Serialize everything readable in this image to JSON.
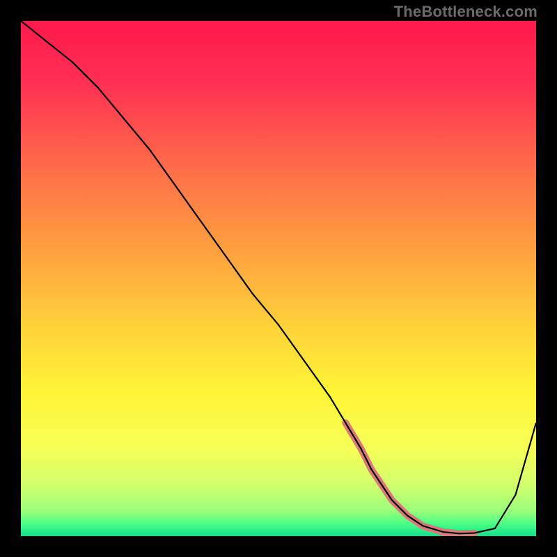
{
  "watermark": "TheBottleneck.com",
  "chart_data": {
    "type": "line",
    "title": "",
    "xlabel": "",
    "ylabel": "",
    "xlim": [
      0,
      100
    ],
    "ylim": [
      0,
      100
    ],
    "grid": false,
    "legend": false,
    "gradient_stops": [
      {
        "pos": 0.0,
        "color": "#ff1a4d"
      },
      {
        "pos": 0.12,
        "color": "#ff3052"
      },
      {
        "pos": 0.28,
        "color": "#ff6b4a"
      },
      {
        "pos": 0.45,
        "color": "#ffa23e"
      },
      {
        "pos": 0.6,
        "color": "#ffd43a"
      },
      {
        "pos": 0.72,
        "color": "#fff536"
      },
      {
        "pos": 0.83,
        "color": "#f6ff57"
      },
      {
        "pos": 0.9,
        "color": "#d2ff6d"
      },
      {
        "pos": 0.95,
        "color": "#9cff7a"
      },
      {
        "pos": 0.975,
        "color": "#4dff86"
      },
      {
        "pos": 1.0,
        "color": "#12e08a"
      }
    ],
    "series": [
      {
        "name": "bottleneck-curve",
        "stroke": "#000000",
        "stroke_width": 2.2,
        "x": [
          0,
          5,
          10,
          15,
          20,
          25,
          30,
          35,
          40,
          45,
          50,
          55,
          60,
          63,
          66,
          68,
          70,
          72,
          75,
          78,
          82,
          85,
          88,
          92,
          96,
          100
        ],
        "y": [
          100,
          96,
          92,
          87,
          81,
          75,
          68,
          61,
          54,
          47,
          41,
          34,
          27,
          22,
          17,
          13,
          10,
          7,
          4,
          2,
          0.8,
          0.5,
          0.6,
          1.5,
          8,
          22
        ]
      },
      {
        "name": "valley-region",
        "stroke": "#d97a7a",
        "stroke_width": 10,
        "linecap": "round",
        "x": [
          63,
          66,
          68,
          70,
          72,
          75,
          78,
          82,
          85,
          88
        ],
        "y": [
          22,
          17,
          13,
          10,
          7,
          4,
          2,
          0.8,
          0.5,
          0.6
        ]
      }
    ]
  }
}
